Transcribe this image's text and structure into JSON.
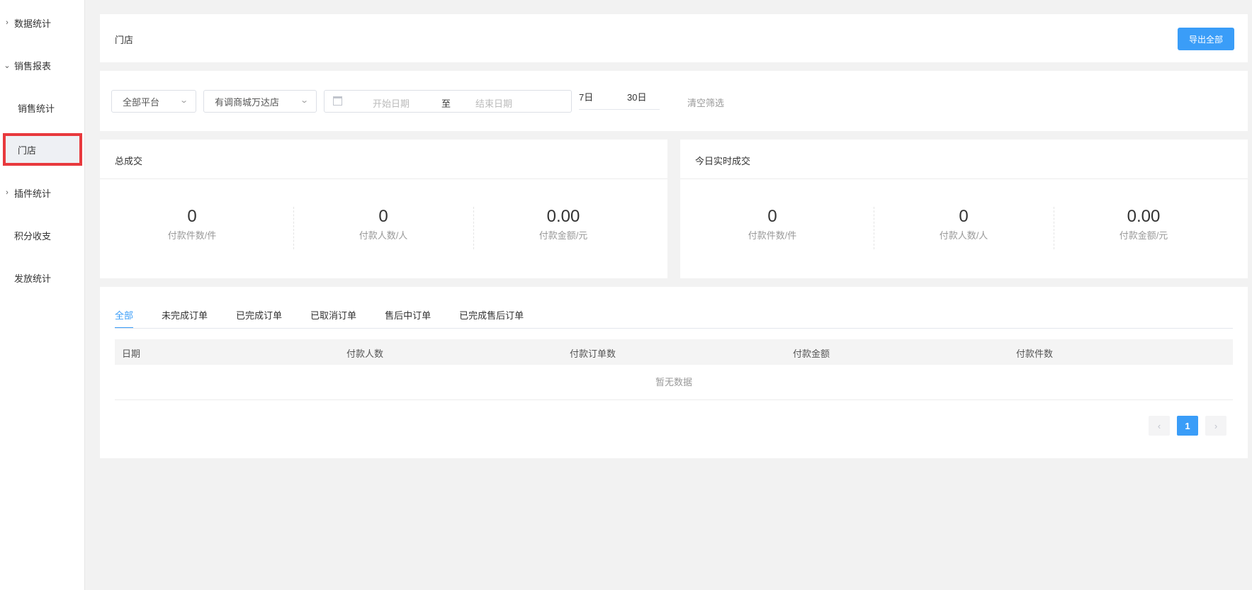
{
  "sidebar": {
    "items": [
      {
        "label": "数据统计",
        "arrow": "›"
      },
      {
        "label": "销售报表",
        "arrow": "⌄"
      },
      {
        "label": "销售统计"
      },
      {
        "label": "门店"
      },
      {
        "label": "插件统计",
        "arrow": "›"
      },
      {
        "label": "积分收支"
      },
      {
        "label": "发放统计"
      }
    ]
  },
  "header": {
    "title": "门店",
    "export_label": "导出全部"
  },
  "filters": {
    "platform": "全部平台",
    "store": "有调商城万达店",
    "start_placeholder": "开始日期",
    "to": "至",
    "end_placeholder": "结束日期",
    "quick_7": "7日",
    "quick_30": "30日",
    "clear": "清空筛选"
  },
  "total": {
    "title": "总成交",
    "stats": [
      {
        "value": "0",
        "label": "付款件数/件"
      },
      {
        "value": "0",
        "label": "付款人数/人"
      },
      {
        "value": "0.00",
        "label": "付款金额/元"
      }
    ]
  },
  "today": {
    "title": "今日实时成交",
    "stats": [
      {
        "value": "0",
        "label": "付款件数/件"
      },
      {
        "value": "0",
        "label": "付款人数/人"
      },
      {
        "value": "0.00",
        "label": "付款金额/元"
      }
    ]
  },
  "orders": {
    "tabs": [
      "全部",
      "未完成订单",
      "已完成订单",
      "已取消订单",
      "售后中订单",
      "已完成售后订单"
    ],
    "columns": [
      "日期",
      "付款人数",
      "付款订单数",
      "付款金额",
      "付款件数"
    ],
    "empty_text": "暂无数据",
    "pager": {
      "prev": "‹",
      "current": "1",
      "next": "›"
    }
  },
  "colors": {
    "accent": "#3a9df8",
    "highlight_border": "#e8393d"
  }
}
